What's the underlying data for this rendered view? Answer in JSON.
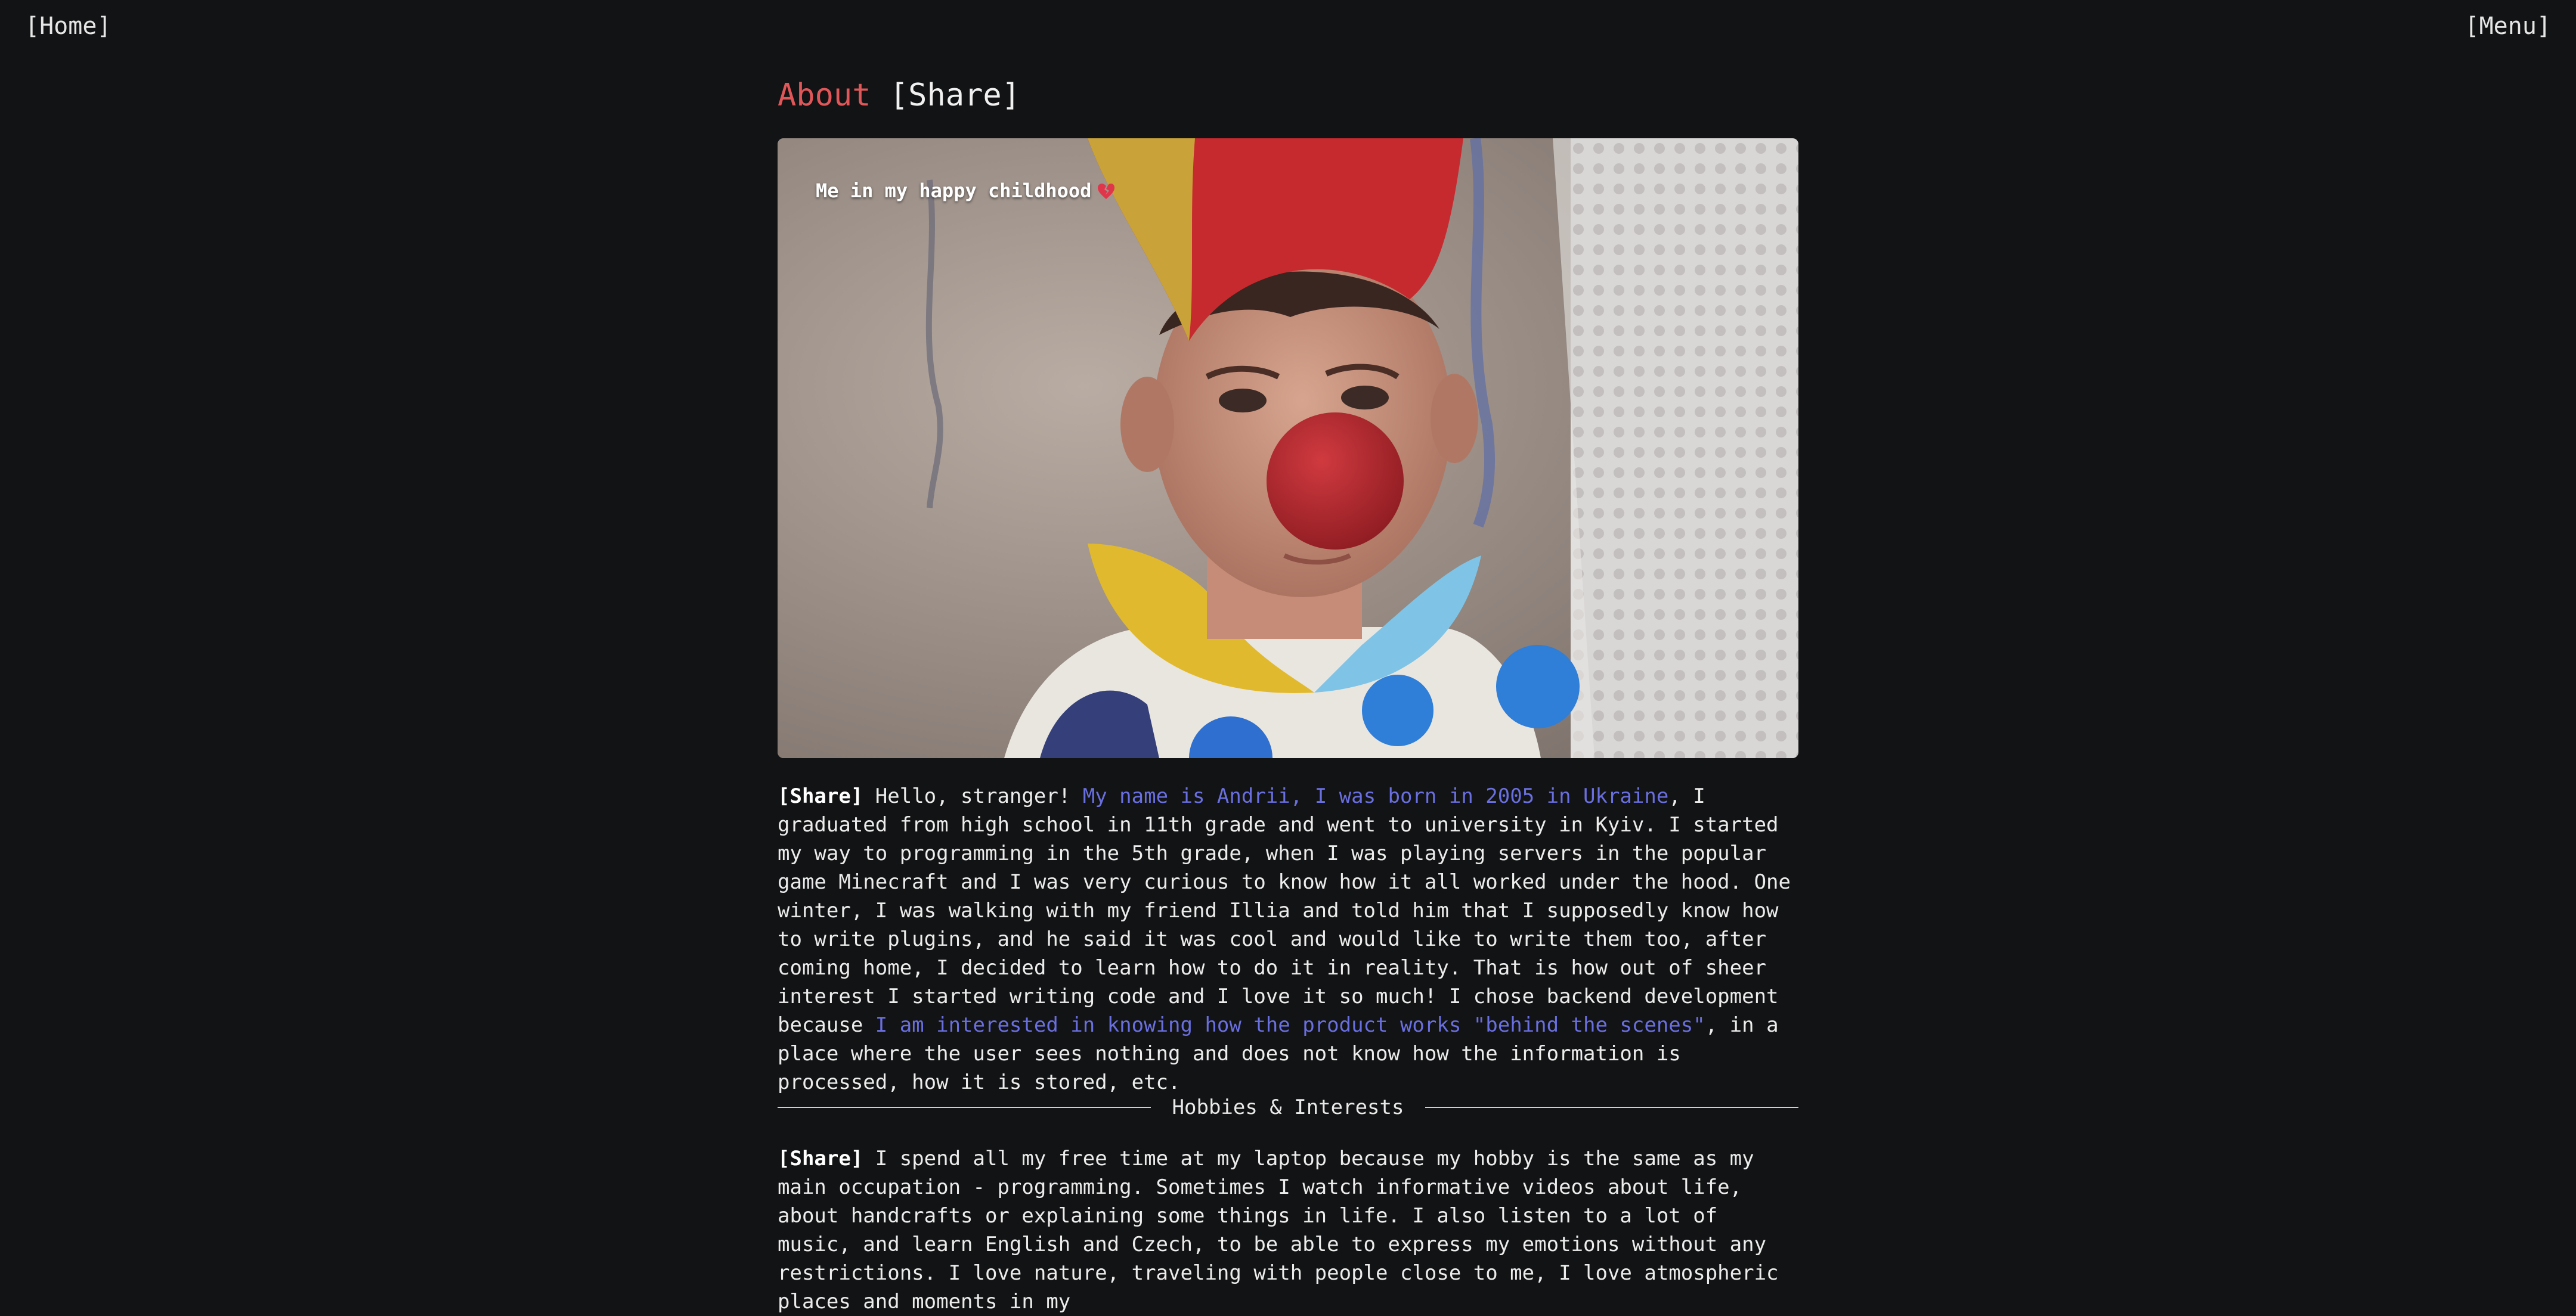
{
  "nav": {
    "home": "[Home]",
    "menu": "[Menu]"
  },
  "heading": {
    "title": "About",
    "share": "[Share]"
  },
  "photo": {
    "caption": "Me in my happy childhood",
    "caption_icon": "broken-heart-icon"
  },
  "about": {
    "share": "[Share]",
    "intro": " Hello, stranger! ",
    "highlight1": "My name is Andrii, I was born in 2005 in Ukraine",
    "body": ", I graduated from high school in 11th grade and went to university in Kyiv. I started my way to programming in the 5th grade, when I was playing servers in the popular game Minecraft and I was very curious to know how it all worked under the hood. One winter, I was walking with my friend Illia and told him that I supposedly know how to write plugins, and he said it was cool and would like to write them too, after coming home, I decided to learn how to do it in reality. That is how out of sheer interest I started writing code and I love it so much! I chose backend development because ",
    "highlight2": "I am interested in knowing how the product works \"behind the scenes\"",
    "tail": ", in a place where the user sees nothing and does not know how the information is processed, how it is stored, etc."
  },
  "divider": {
    "label": "Hobbies & Interests"
  },
  "hobbies": {
    "share": "[Share]",
    "text": " I spend all my free time at my laptop because my hobby is the same as my main occupation - programming. Sometimes I watch informative videos about life, about handcrafts or explaining some things in life. I also listen to a lot of music, and learn English and Czech, to be able to express my emotions without any restrictions. I love nature, traveling with people close to me, I love atmospheric places and moments in my"
  },
  "colors": {
    "background": "#121314",
    "accent": "#e15759",
    "link": "#6a6fe0",
    "text": "#ececec"
  }
}
